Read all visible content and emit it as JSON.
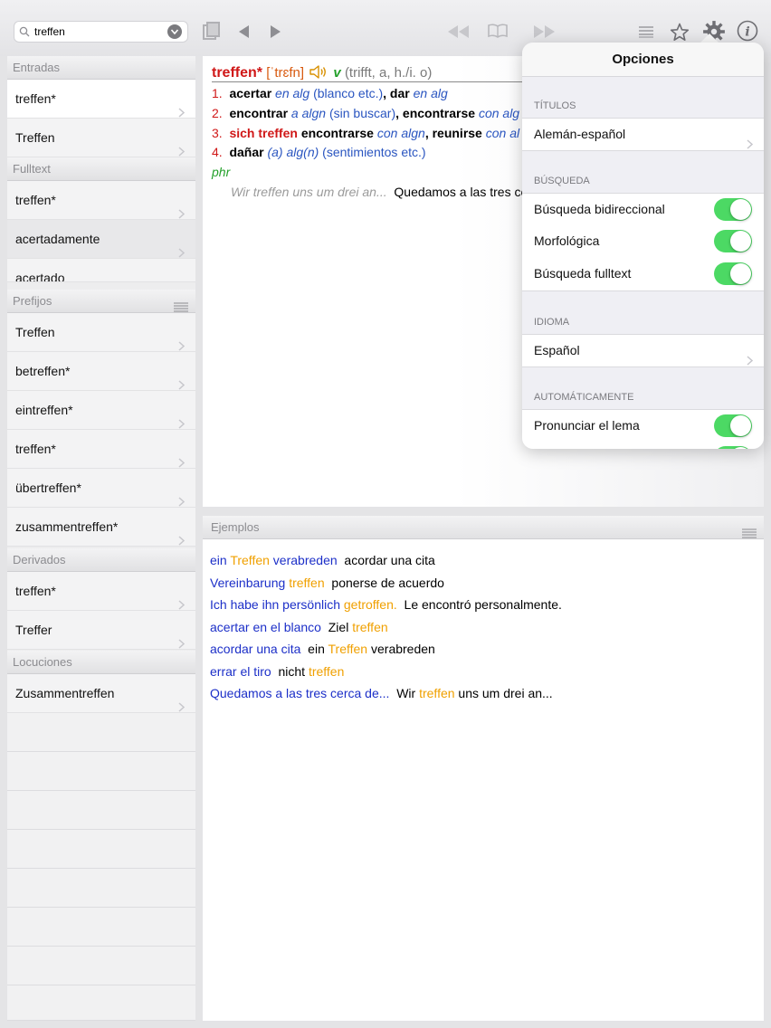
{
  "toolbar": {
    "search_value": "treffen",
    "icons": [
      "search-icon",
      "clear-icon",
      "sync-icon",
      "back-icon",
      "forward-icon",
      "first-icon",
      "book-icon",
      "last-icon",
      "list-icon",
      "star-icon",
      "gear-icon",
      "info-icon"
    ]
  },
  "sidebar": {
    "entradas_label": "Entradas",
    "entradas": [
      "treffen*",
      "Treffen"
    ],
    "fulltext_label": "Fulltext",
    "fulltext": [
      "treffen*",
      "acertadamente",
      "acertado"
    ],
    "prefijos_label": "Prefijos",
    "prefijos": [
      "Treffen",
      "betreffen*",
      "eintreffen*",
      "treffen*",
      "übertreffen*",
      "zusammentreffen*"
    ],
    "derivados_label": "Derivados",
    "derivados": [
      "treffen*",
      "Treffer"
    ],
    "locuciones_label": "Locuciones",
    "locuciones": [
      "Zusammentreffen"
    ]
  },
  "entry": {
    "headword": "treffen*",
    "ipa": "[ˈtrɛfn]",
    "pos": "v",
    "forms": "(trifft, a, h./i. o)",
    "senses": [
      {
        "num": "1.",
        "p1": "acertar",
        "p2": " en alg",
        "p3": " (blanco etc.)",
        "p4": ", dar",
        "p5": " en alg"
      },
      {
        "num": "2.",
        "p1": "encontrar",
        "p2": " a algn",
        "p3": " (sin buscar)",
        "p4": ", encontrarse",
        "p5": " con alg"
      },
      {
        "num": "3.",
        "p1": "sich treffen",
        "p2": " encontrarse",
        "p3": " con algn",
        "p4": ", reunirse",
        "p5": " con al"
      },
      {
        "num": "4.",
        "p1": "dañar",
        "p2": " (a) alg(n)",
        "p3": " (sentimientos etc.)"
      }
    ],
    "phr_label": "phr",
    "phrase_src": "Wir treffen uns um drei an...",
    "phrase_tgt": "Quedamos a las tres ce"
  },
  "examples": {
    "label": "Ejemplos",
    "lines": [
      {
        "a": "ein ",
        "b": "Treffen",
        "c": " verabreden",
        "d": "  acordar una cita",
        "e": ""
      },
      {
        "a": "Vereinbarung ",
        "b": "treffen",
        "c": "",
        "d": "  ponerse de acuerdo",
        "e": ""
      },
      {
        "a": "Ich habe ihn persönlich ",
        "b": "getroffen.",
        "c": "",
        "d": "  Le encontró personalmente.",
        "e": ""
      },
      {
        "a": "acertar en el blanco",
        "b": "",
        "c": "",
        "d": "  Ziel ",
        "e": "treffen"
      },
      {
        "a": "acordar una cita",
        "b": "",
        "c": "",
        "d": "  ein ",
        "e": "Treffen",
        "f": " verabreden"
      },
      {
        "a": "errar el tiro",
        "b": "",
        "c": "",
        "d": "  nicht ",
        "e": "treffen"
      },
      {
        "a": "Quedamos a las tres cerca de...",
        "b": "",
        "c": "",
        "d": "  Wir ",
        "e": "treffen",
        "f": " uns um drei an..."
      }
    ]
  },
  "options": {
    "title": "Opciones",
    "titulos_label": "TÍTULOS",
    "titulos_value": "Alemán-español",
    "busqueda_label": "BÚSQUEDA",
    "bidireccional": "Búsqueda bidireccional",
    "morfologica": "Morfológica",
    "fulltext": "Búsqueda fulltext",
    "idioma_label": "IDIOMA",
    "idioma_value": "Español",
    "auto_label": "AUTOMÁTICAMENTE",
    "pronunciar": "Pronunciar el lema",
    "toggles_on": [
      true,
      true,
      true,
      true,
      true
    ]
  },
  "colors": {
    "headword": "#d01818",
    "ipa": "#d85a10",
    "pos": "#23a02a",
    "italic_blue": "#2a55c0",
    "example_blue": "#1c2fc8",
    "example_orange": "#f0a000",
    "toggle_on": "#4cd964"
  }
}
